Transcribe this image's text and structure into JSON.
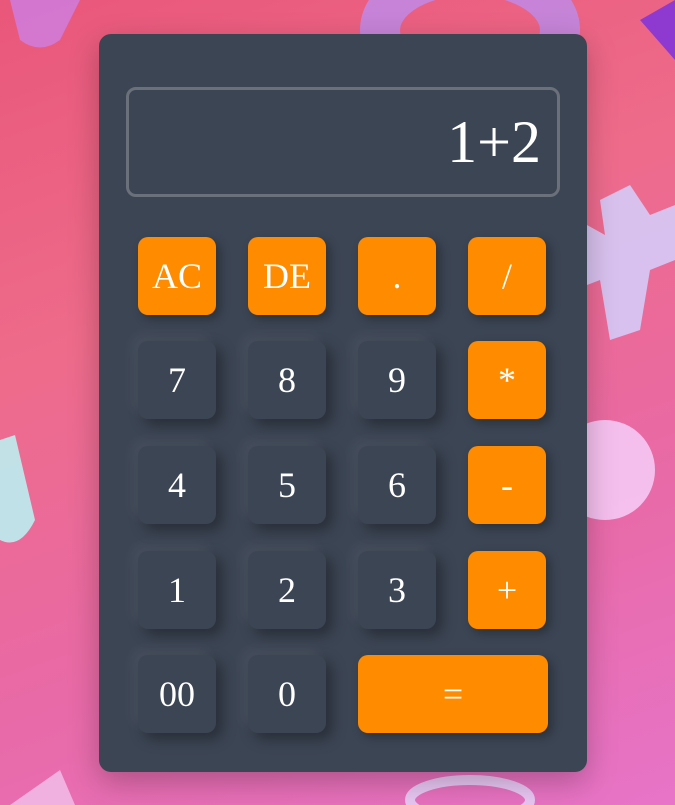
{
  "calculator": {
    "display_value": "1+2",
    "buttons": [
      {
        "label": "AC",
        "kind": "op"
      },
      {
        "label": "DE",
        "kind": "op"
      },
      {
        "label": ".",
        "kind": "op"
      },
      {
        "label": "/",
        "kind": "op"
      },
      {
        "label": "7",
        "kind": "num"
      },
      {
        "label": "8",
        "kind": "num"
      },
      {
        "label": "9",
        "kind": "num"
      },
      {
        "label": "*",
        "kind": "op"
      },
      {
        "label": "4",
        "kind": "num"
      },
      {
        "label": "5",
        "kind": "num"
      },
      {
        "label": "6",
        "kind": "num"
      },
      {
        "label": "-",
        "kind": "op"
      },
      {
        "label": "1",
        "kind": "num"
      },
      {
        "label": "2",
        "kind": "num"
      },
      {
        "label": "3",
        "kind": "num"
      },
      {
        "label": "+",
        "kind": "op"
      },
      {
        "label": "00",
        "kind": "num"
      },
      {
        "label": "0",
        "kind": "num"
      },
      {
        "label": "=",
        "kind": "op"
      }
    ]
  },
  "colors": {
    "panel": "#3c4554",
    "accent": "#ff8c00",
    "background_pink": "#ee6b8a"
  }
}
